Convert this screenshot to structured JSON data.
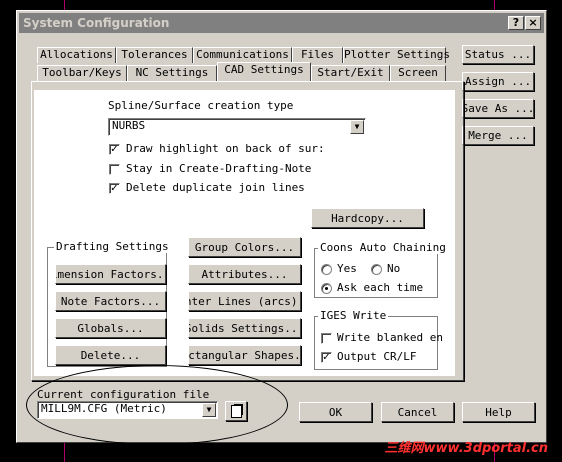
{
  "window": {
    "title": "System Configuration",
    "help_glyph": "?",
    "close_glyph": "×"
  },
  "tabs_row1": [
    "Allocations",
    "Tolerances",
    "Communications",
    "Files",
    "Plotter Settings"
  ],
  "tabs_row2": [
    "Toolbar/Keys",
    "NC Settings",
    "CAD Settings",
    "Start/Exit",
    "Screen"
  ],
  "side_buttons": [
    "Status ...",
    "Assign ...",
    "Save As ...",
    "Merge ..."
  ],
  "cad": {
    "spline_label": "Spline/Surface creation type",
    "spline_value": "NURBS",
    "checks": [
      {
        "label": "Draw highlight on back of sur:",
        "checked": true
      },
      {
        "label": "Stay in Create-Drafting-Note",
        "checked": false
      },
      {
        "label": "Delete duplicate join lines",
        "checked": true
      }
    ],
    "hardcopy": "Hardcopy...",
    "drafting_title": "Drafting Settings",
    "drafting_buttons": [
      "imension Factors..",
      "Note Factors...",
      "Globals...",
      "Delete..."
    ],
    "mid_buttons": [
      "Group Colors...",
      "Attributes...",
      "nter Lines (arcs).",
      "Solids Settings...",
      "ectangular Shapes.."
    ],
    "coons_title": "Coons Auto Chaining",
    "coons_yes": "Yes",
    "coons_no": "No",
    "coons_ask": "Ask each time",
    "iges_title": "IGES Write",
    "iges_checks": [
      {
        "label": "Write blanked en",
        "checked": false
      },
      {
        "label": "Output CR/LF",
        "checked": true
      }
    ]
  },
  "footer": {
    "config_label": "Current configuration file",
    "config_value": "MILL9M.CFG (Metric)",
    "ok": "OK",
    "cancel": "Cancel",
    "help": "Help"
  },
  "watermark": "三维网www.3dportal.cn"
}
